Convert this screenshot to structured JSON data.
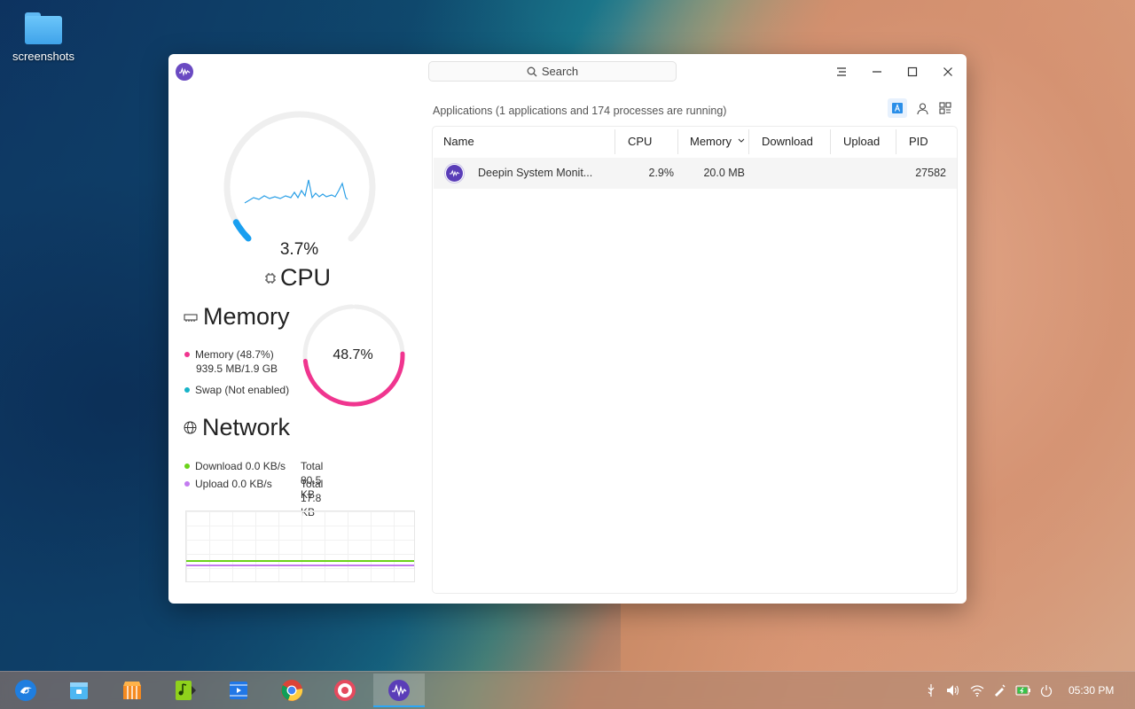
{
  "desktop": {
    "folder_label": "screenshots"
  },
  "window": {
    "search_label": "Search",
    "cpu": {
      "value_text": "3.7%",
      "title": "CPU",
      "usage_fraction": 0.037
    },
    "memory": {
      "title": "Memory",
      "value_text": "48.7%",
      "usage_fraction": 0.487,
      "legend_memory": "Memory (48.7%)",
      "legend_memory_detail": "939.5 MB/1.9 GB",
      "legend_swap": "Swap (Not enabled)",
      "memory_color": "#f0358f",
      "swap_color": "#16b3c8"
    },
    "network": {
      "title": "Network",
      "download": "Download 0.0 KB/s",
      "download_total": "Total 80.5 KB",
      "upload": "Upload 0.0 KB/s",
      "upload_total": "Total 17.8 KB",
      "download_color": "#6bd31a",
      "upload_color": "#c37bf0"
    },
    "apps_title": "Applications (1 applications and 174 processes are running)",
    "columns": {
      "name": "Name",
      "cpu": "CPU",
      "memory": "Memory",
      "download": "Download",
      "upload": "Upload",
      "pid": "PID"
    },
    "rows": [
      {
        "name": "Deepin System Monit...",
        "cpu": "2.9%",
        "memory": "20.0 MB",
        "download": "",
        "upload": "",
        "pid": "27582"
      }
    ]
  },
  "taskbar": {
    "apps": [
      "launcher-icon",
      "file-manager-icon",
      "app-store-icon",
      "music-icon",
      "video-icon",
      "chrome-icon",
      "settings-icon",
      "system-monitor-icon"
    ],
    "clock": "05:30 PM"
  }
}
